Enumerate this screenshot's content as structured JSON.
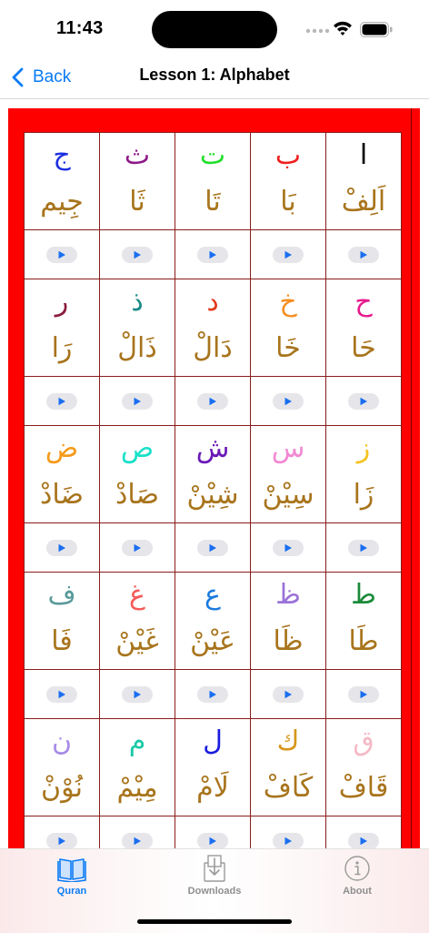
{
  "status": {
    "time": "11:43"
  },
  "nav": {
    "back_label": "Back",
    "title": "Lesson 1: Alphabet"
  },
  "colors": {
    "accent": "#0a7bf6",
    "board": "#ff0000",
    "name_text": "#a8741c"
  },
  "alphabet": [
    [
      {
        "letter": "ا",
        "name": "اَلِفْ",
        "color": "#000000"
      },
      {
        "letter": "ب",
        "name": "بَا",
        "color": "#f01e1e"
      },
      {
        "letter": "ت",
        "name": "تَا",
        "color": "#22e02a"
      },
      {
        "letter": "ث",
        "name": "ثَا",
        "color": "#8e1a8a"
      },
      {
        "letter": "ج",
        "name": "جِيم",
        "color": "#1c2fe0"
      }
    ],
    [
      {
        "letter": "ح",
        "name": "حَا",
        "color": "#e81a8e"
      },
      {
        "letter": "خ",
        "name": "خَا",
        "color": "#f58e1f"
      },
      {
        "letter": "د",
        "name": "دَالْ",
        "color": "#e23b1a"
      },
      {
        "letter": "ذ",
        "name": "ذَالْ",
        "color": "#1a8a86"
      },
      {
        "letter": "ر",
        "name": "رَا",
        "color": "#8a1a3c"
      }
    ],
    [
      {
        "letter": "ز",
        "name": "زَا",
        "color": "#f5c21a"
      },
      {
        "letter": "س",
        "name": "سِيْنْ",
        "color": "#f28ad2"
      },
      {
        "letter": "ش",
        "name": "شِيْنْ",
        "color": "#6a1ab8"
      },
      {
        "letter": "ص",
        "name": "صَادْ",
        "color": "#1ae0c8"
      },
      {
        "letter": "ض",
        "name": "ضَادْ",
        "color": "#f59a1a"
      }
    ],
    [
      {
        "letter": "ط",
        "name": "طَا",
        "color": "#1a8a3a"
      },
      {
        "letter": "ظ",
        "name": "ظَا",
        "color": "#9a72d8"
      },
      {
        "letter": "ع",
        "name": "عَيْنْ",
        "color": "#1a7ae0"
      },
      {
        "letter": "غ",
        "name": "غَيْنْ",
        "color": "#f55a5a"
      },
      {
        "letter": "ف",
        "name": "فَا",
        "color": "#5a9a9a"
      }
    ],
    [
      {
        "letter": "ق",
        "name": "قَافْ",
        "color": "#f5b8c4"
      },
      {
        "letter": "ك",
        "name": "كَافْ",
        "color": "#d8961a"
      },
      {
        "letter": "ل",
        "name": "لَامْ",
        "color": "#1a1ae0"
      },
      {
        "letter": "م",
        "name": "مِيْمْ",
        "color": "#1acaa8"
      },
      {
        "letter": "ن",
        "name": "نُوْنْ",
        "color": "#a88ae8"
      }
    ]
  ],
  "tabs": [
    {
      "label": "Quran",
      "icon": "book-icon",
      "active": true
    },
    {
      "label": "Downloads",
      "icon": "download-icon",
      "active": false
    },
    {
      "label": "About",
      "icon": "info-icon",
      "active": false
    }
  ]
}
